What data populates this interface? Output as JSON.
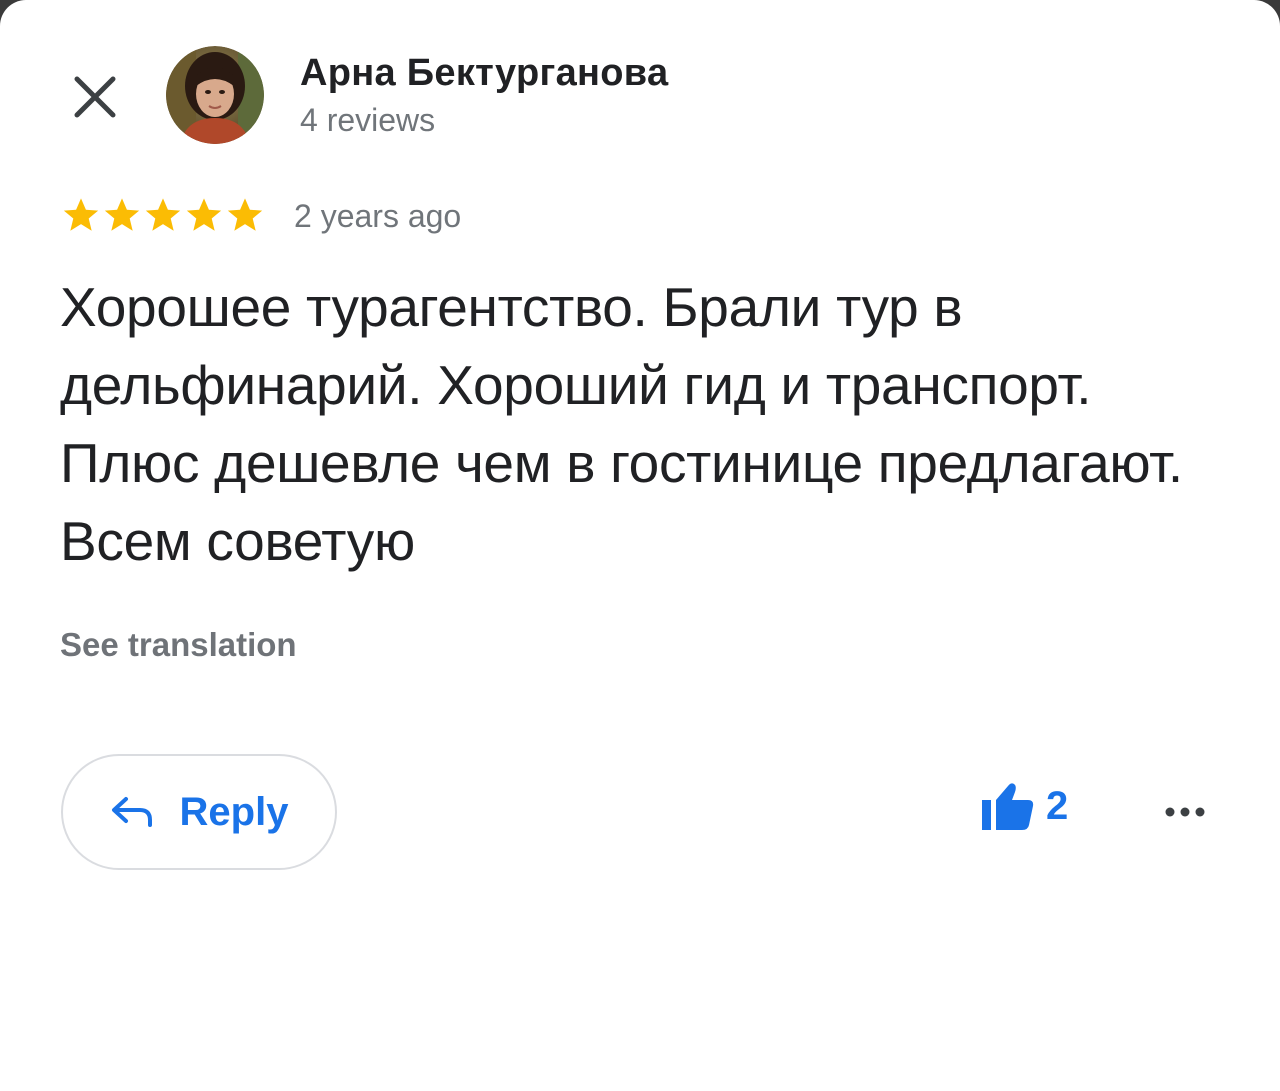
{
  "header": {
    "author_name": "Арна Бектурганова",
    "author_reviews": "4 reviews",
    "close_icon": "close-icon",
    "avatar_icon": "avatar"
  },
  "review": {
    "rating": 5,
    "rating_max": 5,
    "date": "2 years ago",
    "text": "Хорошее турагентство. Брали тур в дельфинарий. Хороший гид и транспорт. Плюс дешевле чем в гостинице предлагают. Всем советую",
    "see_translation_label": "See translation"
  },
  "actions": {
    "reply_label": "Reply",
    "reply_icon": "reply-arrow-icon",
    "like_icon": "thumbs-up-icon",
    "like_count": "2",
    "more_icon": "more-horizontal-icon"
  },
  "colors": {
    "star": "#fbbc04",
    "accent": "#1a73e8",
    "text_primary": "#202124",
    "text_secondary": "#70757a",
    "border": "#dadce0"
  }
}
